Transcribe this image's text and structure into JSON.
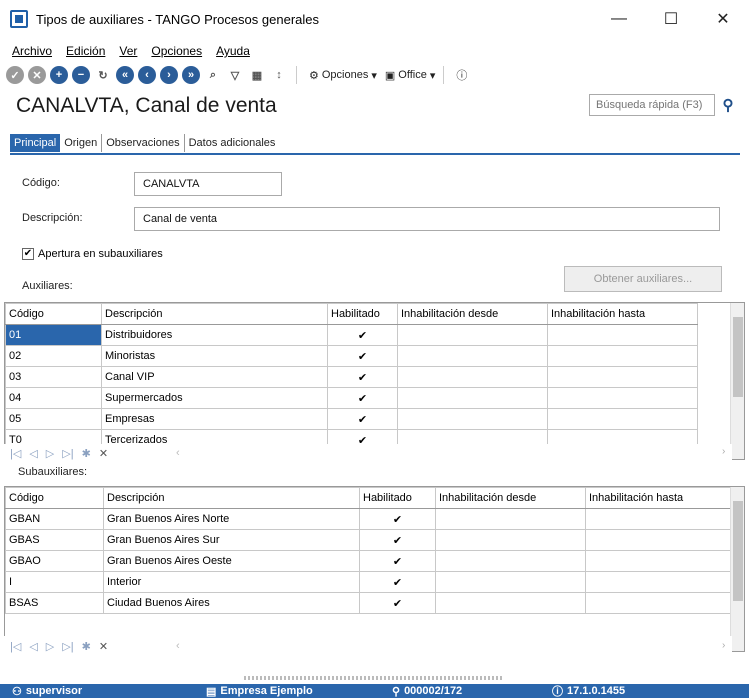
{
  "window": {
    "title": "Tipos de auxiliares - TANGO Procesos generales",
    "minimize": "—",
    "maximize": "☐",
    "close": "✕"
  },
  "menu": [
    "Archivo",
    "Edición",
    "Ver",
    "Opciones",
    "Ayuda"
  ],
  "toolbar": {
    "opciones_label": "Opciones",
    "office_label": "Office"
  },
  "header": {
    "title": "CANALVTA, Canal de venta",
    "search_placeholder": "Búsqueda rápida (F3)"
  },
  "tabs": [
    "Principal",
    "Origen",
    "Observaciones",
    "Datos adicionales"
  ],
  "form": {
    "codigo_label": "Código:",
    "codigo_value": "CANALVTA",
    "descripcion_label": "Descripción:",
    "descripcion_value": "Canal de venta",
    "apertura_label": "Apertura en subauxiliares",
    "auxiliares_label": "Auxiliares:",
    "obtener_button": "Obtener auxiliares...",
    "subauxiliares_label": "Subauxiliares:"
  },
  "columns": [
    "Código",
    "Descripción",
    "Habilitado",
    "Inhabilitación desde",
    "Inhabilitación hasta"
  ],
  "auxiliares": [
    {
      "code": "01",
      "desc": "Distribuidores",
      "check": "✔"
    },
    {
      "code": "02",
      "desc": "Minoristas",
      "check": "✔"
    },
    {
      "code": "03",
      "desc": "Canal VIP",
      "check": "✔"
    },
    {
      "code": "04",
      "desc": "Supermercados",
      "check": "✔"
    },
    {
      "code": "05",
      "desc": "Empresas",
      "check": "✔"
    },
    {
      "code": "T0",
      "desc": "Tercerizados",
      "check": "✔"
    }
  ],
  "subauxiliares": [
    {
      "code": "GBAN",
      "desc": "Gran Buenos Aires Norte",
      "check": "✔"
    },
    {
      "code": "GBAS",
      "desc": "Gran Buenos Aires Sur",
      "check": "✔"
    },
    {
      "code": "GBAO",
      "desc": "Gran Buenos Aires Oeste",
      "check": "✔"
    },
    {
      "code": "I",
      "desc": "Interior",
      "check": "✔"
    },
    {
      "code": "BSAS",
      "desc": "Ciudad Buenos Aires",
      "check": "✔"
    }
  ],
  "status": {
    "user": "supervisor",
    "company": "Empresa Ejemplo",
    "code": "000002/172",
    "version": "17.1.0.1455"
  }
}
